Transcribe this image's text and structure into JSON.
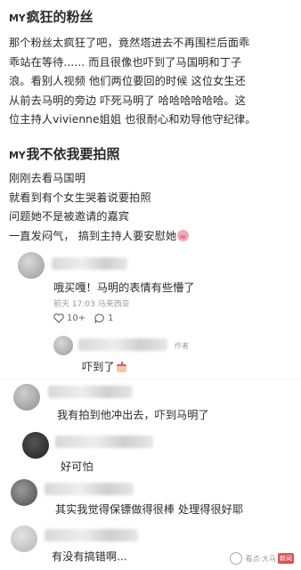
{
  "posts": [
    {
      "prefix": "MY",
      "name": "疯狂的粉丝",
      "lines": [
        "那个粉丝太疯狂了吧，竟然塔进去不再围栏后面乖",
        "乖站在等待...... 而且很像也吓到了马国明和丁子",
        "浪。看别人视频 他们两位要回的时候 这位女生还",
        "从前去马明的旁边 吓死马明了 哈哈哈哈哈哈。这",
        "位主持人vivienne姐姐 也很耐心和劝导他守纪律。"
      ]
    },
    {
      "prefix": "MY",
      "name": "我不依我要拍照",
      "lines": [
        "刚刚去看马国明",
        "就看到有个女生哭着说要拍照",
        "问题她不是被邀请的嘉宾",
        "一直发闷气，  搞到主持人要安慰她"
      ]
    }
  ],
  "comments": [
    {
      "text": "哦买嘎！马明的表情有些懵了",
      "meta": "前天 17:03 马来西亚",
      "likes": "10+",
      "replies": "1"
    },
    {
      "author_tag": "作者",
      "text": "吓到了"
    },
    {
      "text": "我有拍到他冲出去，吓到马明了"
    },
    {
      "text": "好可怕"
    },
    {
      "text": "其实我觉得保镖做得很棒 处理得很好耶"
    },
    {
      "text": "有没有搞错啊..."
    }
  ],
  "watermark": {
    "text": "看点·大马",
    "badge": "新闻"
  },
  "icons": {
    "like": "heart-icon",
    "reply": "comment-icon",
    "emoji_pig": "pig-face-emoji",
    "emoji_cake": "cake-emoji"
  }
}
